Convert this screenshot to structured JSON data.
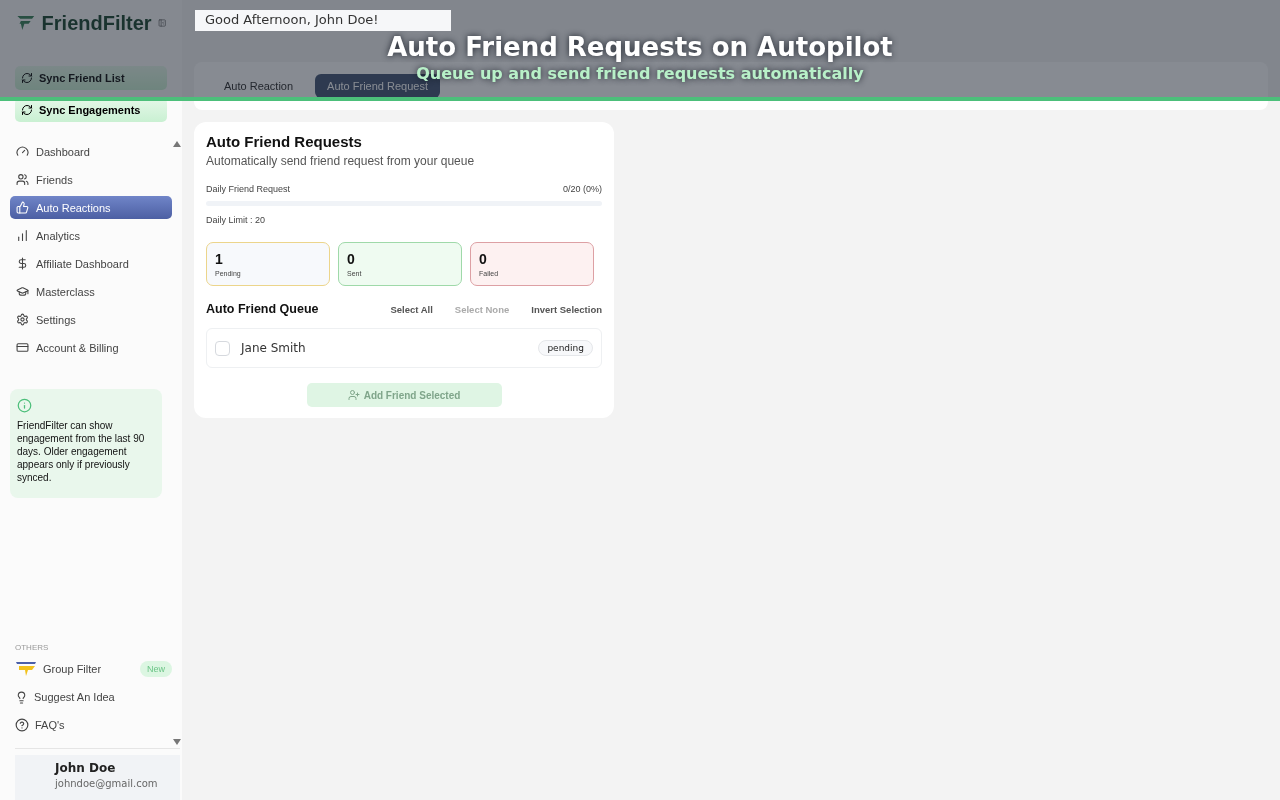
{
  "banner": {
    "title": "Auto Friend Requests on Autopilot",
    "subtitle": "Queue up and send friend requests automatically"
  },
  "greeting": "Good Afternoon, John Doe!",
  "brand": "FriendFilter",
  "sync_buttons": [
    "Sync Friend List",
    "Sync Engagements"
  ],
  "nav": [
    {
      "label": "Dashboard",
      "selected": false
    },
    {
      "label": "Friends",
      "selected": false
    },
    {
      "label": "Auto Reactions",
      "selected": true
    },
    {
      "label": "Analytics",
      "selected": false
    },
    {
      "label": "Affiliate Dashboard",
      "selected": false
    },
    {
      "label": "Masterclass",
      "selected": false
    },
    {
      "label": "Settings",
      "selected": false
    },
    {
      "label": "Account & Billing",
      "selected": false
    }
  ],
  "info_note": "FriendFilter can show engagement from the last 90 days. Older engagement appears only if previously synced.",
  "others": {
    "heading": "OTHERS",
    "items": [
      {
        "label": "Group Filter",
        "badge": "New"
      },
      {
        "label": "Suggest An Idea"
      },
      {
        "label": "FAQ's"
      }
    ]
  },
  "user": {
    "name": "John Doe",
    "email": "johndoe@gmail.com"
  },
  "tabs": [
    {
      "label": "Auto Reaction",
      "selected": false
    },
    {
      "label": "Auto Friend Request",
      "selected": true
    }
  ],
  "card": {
    "title": "Auto Friend Requests",
    "subtitle": "Automatically send friend request from your queue",
    "progress": {
      "label": "Daily Friend Request",
      "reading": "0/20 (0%)",
      "level": 0,
      "limit": "Daily Limit : 20"
    },
    "stats": [
      {
        "kind": "pending",
        "value": "1",
        "label": "Pending"
      },
      {
        "kind": "sent",
        "value": "0",
        "label": "Sent"
      },
      {
        "kind": "failed",
        "value": "0",
        "label": "Failed"
      }
    ],
    "queue": {
      "title": "Auto Friend Queue",
      "actions": [
        {
          "label": "Select All",
          "disabled": false
        },
        {
          "label": "Select None",
          "disabled": true
        },
        {
          "label": "Invert Selection",
          "disabled": false
        }
      ],
      "rows": [
        {
          "name": "Jane Smith",
          "checked": false,
          "status": "pending"
        }
      ]
    },
    "add_button": {
      "label": "Add Friend Selected",
      "disabled": true
    }
  }
}
